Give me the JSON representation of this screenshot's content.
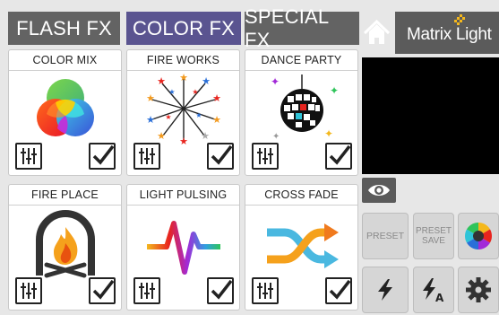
{
  "tabs": {
    "flash_fx": "FLASH FX",
    "color_fx": "COLOR FX",
    "special_fx": "SPECIAL FX"
  },
  "active_tab": "color_fx",
  "logo": {
    "text": "Matrix Light"
  },
  "effects": [
    {
      "title": "COLOR MIX",
      "icon": "color-mix-icon",
      "checked": true
    },
    {
      "title": "FIRE WORKS",
      "icon": "fireworks-icon",
      "checked": true
    },
    {
      "title": "DANCE PARTY",
      "icon": "disco-ball-icon",
      "checked": true
    },
    {
      "title": "FIRE PLACE",
      "icon": "fireplace-icon",
      "checked": true
    },
    {
      "title": "LIGHT PULSING",
      "icon": "pulse-icon",
      "checked": true
    },
    {
      "title": "CROSS FADE",
      "icon": "crossfade-icon",
      "checked": true
    }
  ],
  "controls": {
    "preset_label": "PRESET",
    "preset_save_line1": "PRESET",
    "preset_save_line2": "SAVE"
  },
  "colors": {
    "tab_inactive": "#636363",
    "tab_active": "#5a5490",
    "preview_bg": "#000000"
  }
}
